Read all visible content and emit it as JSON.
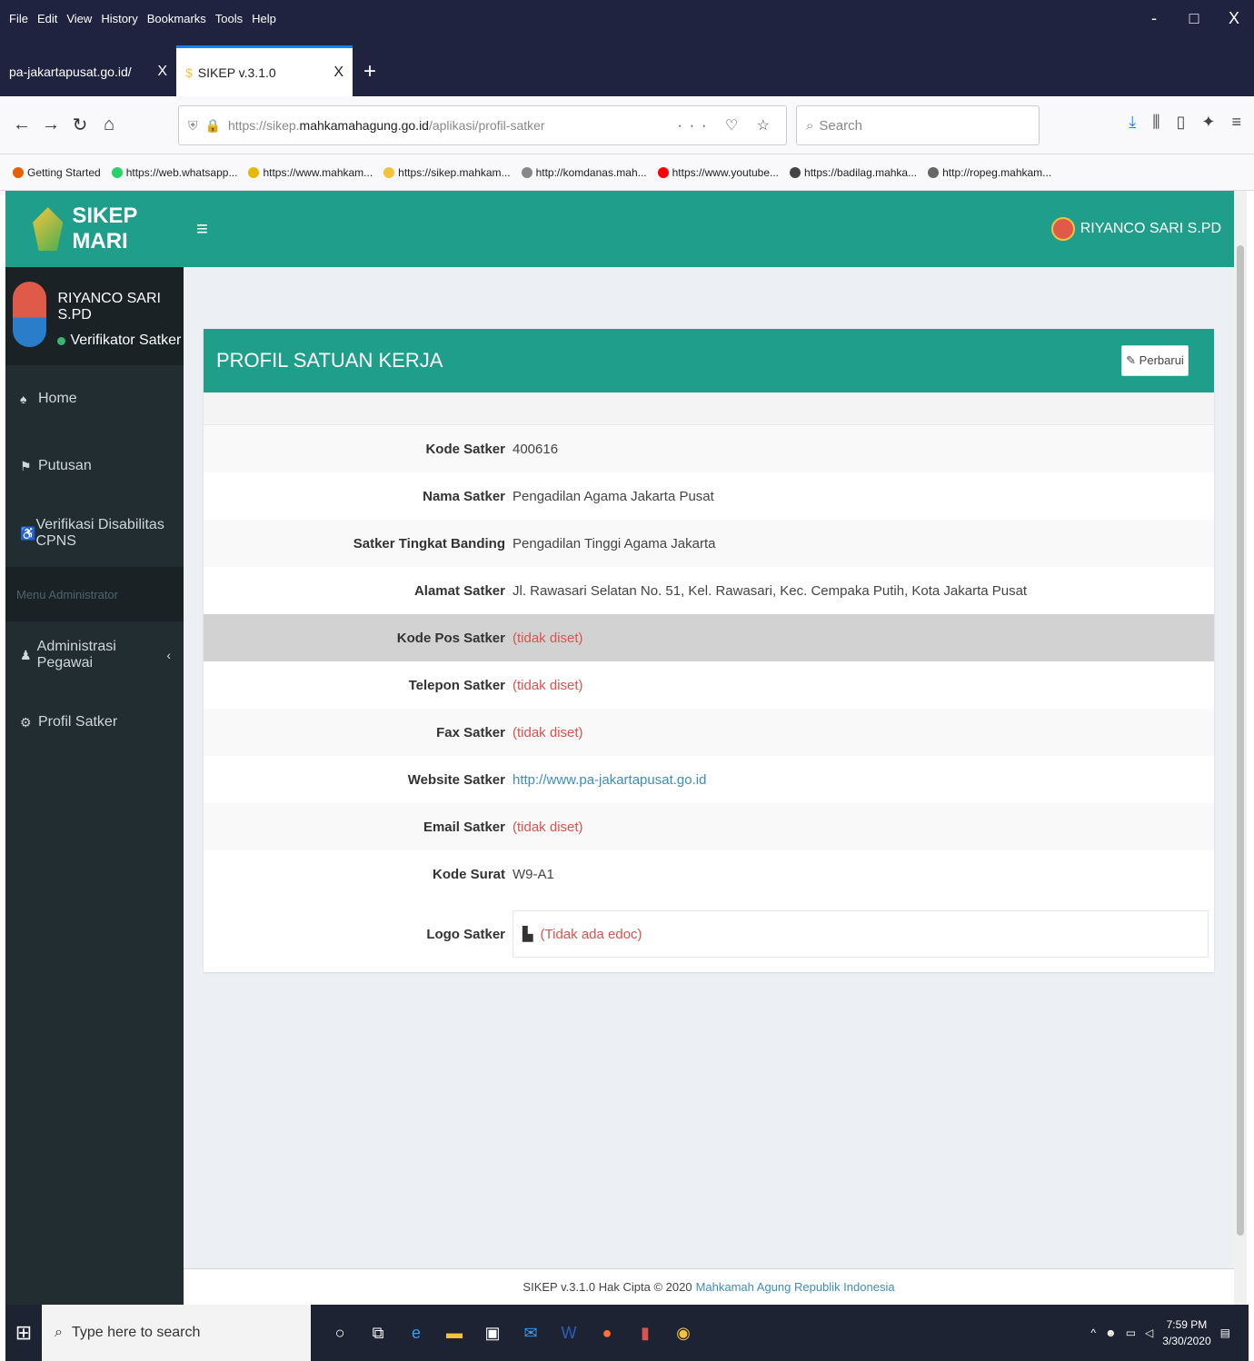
{
  "browser": {
    "menu": [
      "File",
      "Edit",
      "View",
      "History",
      "Bookmarks",
      "Tools",
      "Help"
    ],
    "window_controls": [
      "-",
      "□",
      "X"
    ],
    "tabs": [
      {
        "label": "pa-jakartapusat.go.id/",
        "close": "X"
      },
      {
        "label": "SIKEP v.3.1.0",
        "close": "X"
      }
    ],
    "new_tab": "+",
    "url_prefix": "https://sikep.",
    "url_domain": "mahkamahagung.go.id",
    "url_path": "/aplikasi/profil-satker",
    "url_actions": "··· ♡ ☆",
    "search_placeholder": "Search",
    "bookmarks": [
      {
        "label": "Getting Started",
        "color": "#e66000"
      },
      {
        "label": "https://web.whatsapp...",
        "color": "#25d366"
      },
      {
        "label": "https://www.mahkam...",
        "color": "#e6b800"
      },
      {
        "label": "https://sikep.mahkam...",
        "color": "#f4c23b"
      },
      {
        "label": "http://komdanas.mah...",
        "color": "#888888"
      },
      {
        "label": "https://www.youtube...",
        "color": "#ff0000"
      },
      {
        "label": "https://badilag.mahka...",
        "color": "#444444"
      },
      {
        "label": "http://ropeg.mahkam...",
        "color": "#666666"
      }
    ]
  },
  "app": {
    "logo_text": "SIKEP MARI",
    "hamburger": "≡",
    "header_user": "RIYANCO SARI S.PD",
    "sidebar": {
      "user_name": "RIYANCO SARI S.PD",
      "user_role": "Verifikator Satker",
      "items": [
        {
          "icon": "♠",
          "label": "Home"
        },
        {
          "icon": "⚑",
          "label": "Putusan"
        },
        {
          "icon": "♿",
          "label": "Verifikasi Disabilitas CPNS"
        }
      ],
      "section_header": "Menu Administrator",
      "items2": [
        {
          "icon": "♟",
          "label": "Administrasi Pegawai",
          "chevron": "‹"
        },
        {
          "icon": "⚙",
          "label": "Profil Satker"
        }
      ]
    },
    "panel": {
      "title": "PROFIL SATUAN KERJA",
      "edit_label": "✎ Perbarui",
      "rows": [
        {
          "label": "Kode Satker",
          "value": "400616",
          "kind": "normal"
        },
        {
          "label": "Nama Satker",
          "value": "Pengadilan Agama Jakarta Pusat",
          "kind": "normal"
        },
        {
          "label": "Satker Tingkat Banding",
          "value": "Pengadilan Tinggi Agama Jakarta",
          "kind": "normal"
        },
        {
          "label": "Alamat Satker",
          "value": "Jl. Rawasari Selatan No. 51, Kel. Rawasari, Kec. Cempaka Putih, Kota Jakarta Pusat",
          "kind": "normal"
        },
        {
          "label": "Kode Pos Satker",
          "value": "(tidak diset)",
          "kind": "unset"
        },
        {
          "label": "Telepon Satker",
          "value": "(tidak diset)",
          "kind": "unset"
        },
        {
          "label": "Fax Satker",
          "value": "(tidak diset)",
          "kind": "unset"
        },
        {
          "label": "Website Satker",
          "value": "http://www.pa-jakartapusat.go.id",
          "kind": "link"
        },
        {
          "label": "Email Satker",
          "value": "(tidak diset)",
          "kind": "unset"
        },
        {
          "label": "Kode Surat",
          "value": "W9-A1",
          "kind": "normal"
        }
      ],
      "logo_label": "Logo Satker",
      "logo_value": "(Tidak ada edoc)"
    },
    "footer_text": "SIKEP v.3.1.0 Hak Cipta © 2020",
    "footer_link": "Mahkamah Agung Republik Indonesia"
  },
  "taskbar": {
    "search_placeholder": "Type here to search",
    "time": "7:59 PM",
    "date": "3/30/2020"
  },
  "colors": {
    "accent": "#1e9e8b",
    "sidebar": "#222d32",
    "unset_text": "#d9534f",
    "link": "#3c8dbc"
  }
}
